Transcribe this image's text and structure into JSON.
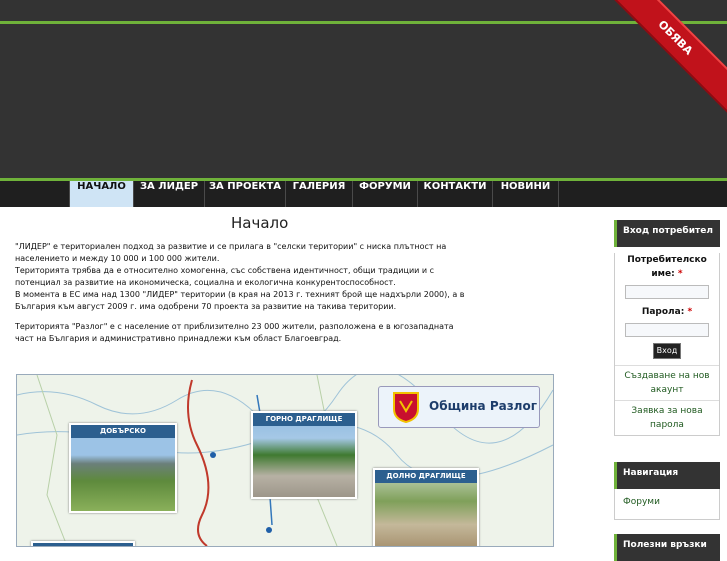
{
  "ribbon": "ОБЯВА",
  "nav": {
    "items": [
      "НАЧАЛО",
      "ЗА ЛИДЕР",
      "ЗА ПРОЕКТА",
      "ГАЛЕРИЯ",
      "ФОРУМИ",
      "КОНТАКТИ",
      "НОВИНИ"
    ]
  },
  "main": {
    "title": "Начало",
    "p1": [
      "\"ЛИДЕР\" е териториален подход за развитие и се прилага в \"селски територии\" с ниска плътност на",
      "населението и между 10 000 и 100 000 жители.",
      "Територията трябва да е относително хомогенна, със собствена идентичност, общи традиции и с",
      "потенциал за развитие на икономическа, социална и екологична конкурентоспособност.",
      "В момента в ЕС има над 1300 \"ЛИДЕР\" територии (в края на 2013 г. техният брой ще надхърли 2000), а в",
      "България към август 2009 г. има одобрени 70 проекта за развитие на такива територии."
    ],
    "p2": [
      "Територията \"Разлог\"  е с население от приблизително 23 000 жители, разположена е в югозападната",
      "част на България  и административно принадлежи към област Благоевград."
    ]
  },
  "map": {
    "logo_text": "Община Разлог",
    "places": [
      "ДОБЪРСКО",
      "ГОРНО ДРАГЛИЩЕ",
      "ДОЛНО ДРАГЛИЩЕ"
    ]
  },
  "login": {
    "header": "Вход потребител",
    "username_label": "Потребителско име:",
    "required": "*",
    "password_label": "Парола:",
    "submit": "Вход",
    "create_account": "Създаване на нов акаунт",
    "new_password": "Заявка за нова парола"
  },
  "navigation": {
    "header": "Навигация",
    "items": [
      "Форуми"
    ]
  },
  "useful_links": {
    "header": "Полезни връзки"
  }
}
